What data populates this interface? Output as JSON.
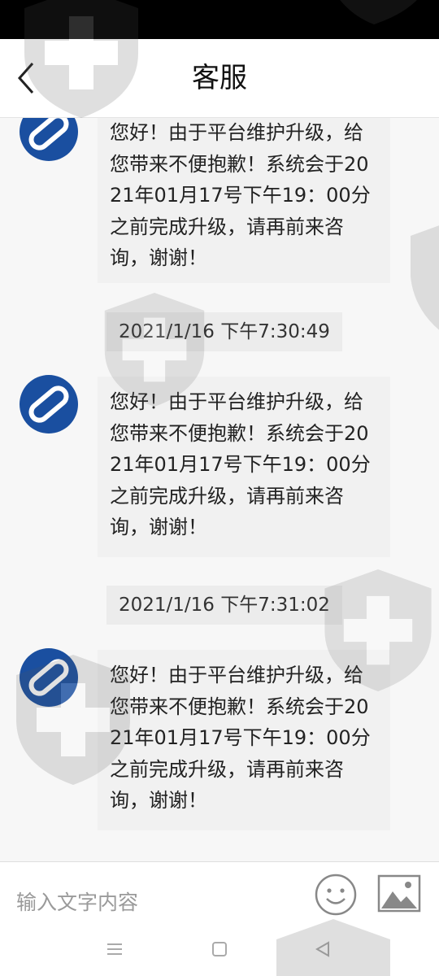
{
  "header": {
    "title": "客服",
    "back_icon": "chevron-left-icon"
  },
  "messages": [
    {
      "type": "incoming",
      "text": "您好！由于平台维护升级，给您带来不便抱歉！系统会于2021年01月17号下午19：00分之前完成升级，请再前来咨询，谢谢！"
    },
    {
      "type": "timestamp",
      "text": "2021/1/16 下午7:30:49"
    },
    {
      "type": "incoming",
      "text": "您好！由于平台维护升级，给您带来不便抱歉！系统会于2021年01月17号下午19：00分之前完成升级，请再前来咨询，谢谢！"
    },
    {
      "type": "timestamp",
      "text": "2021/1/16 下午7:31:02"
    },
    {
      "type": "incoming",
      "text": "您好！由于平台维护升级，给您带来不便抱歉！系统会于2021年01月17号下午19：00分之前完成升级，请再前来咨询，谢谢！"
    }
  ],
  "input_bar": {
    "placeholder": "输入文字内容",
    "value": "",
    "emoji_icon": "smiley-icon",
    "image_icon": "image-icon"
  },
  "system_nav": {
    "icons": [
      "menu-icon",
      "home-icon",
      "back-triangle-icon"
    ]
  },
  "colors": {
    "avatar_blue": "#1a4fa0",
    "bubble_bg": "#f1f1f1",
    "timestamp_bg": "#ececec",
    "chat_bg": "#f7f7f7"
  }
}
